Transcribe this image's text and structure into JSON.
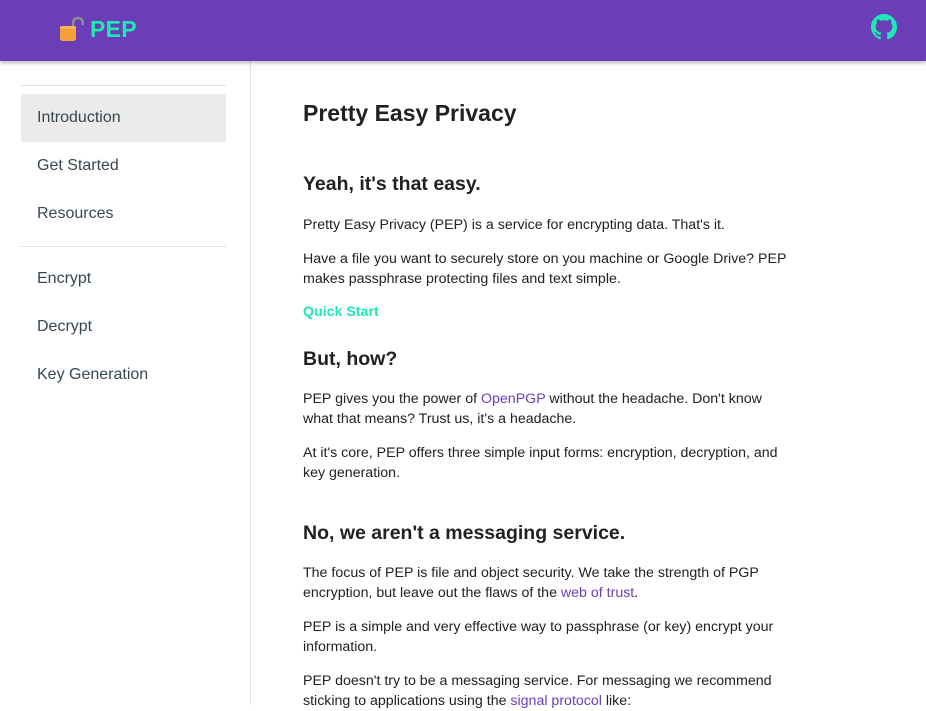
{
  "header": {
    "brand_name": "PEP",
    "logo_icon": "padlock-icon",
    "github_icon": "github-icon",
    "colors": {
      "bar": "#6b3eb8",
      "brand": "#1de9b6"
    }
  },
  "sidebar": {
    "group1": [
      {
        "label": "Introduction",
        "active": true
      },
      {
        "label": "Get Started"
      },
      {
        "label": "Resources"
      }
    ],
    "group2": [
      {
        "label": "Encrypt"
      },
      {
        "label": "Decrypt"
      },
      {
        "label": "Key Generation"
      }
    ]
  },
  "main": {
    "title": "Pretty Easy Privacy",
    "s1": {
      "heading": "Yeah, it's that easy.",
      "p1": "Pretty Easy Privacy (PEP) is a service for encrypting data. That's it.",
      "p2": "Have a file you want to securely store on you machine or Google Drive? PEP makes passphrase protecting files and text simple.",
      "cta": "Quick Start"
    },
    "s2": {
      "heading": "But, how?",
      "p1_pre": "PEP gives you the power of ",
      "p1_link": "OpenPGP",
      "p1_post": " without the headache. Don't know what that means? Trust us, it's a headache.",
      "p2": "At it's core, PEP offers three simple input forms: encryption, decryption, and key generation."
    },
    "s3": {
      "heading": "No, we aren't a messaging service.",
      "p1_pre": "The focus of PEP is file and object security. We take the strength of PGP encryption, but leave out the flaws of the ",
      "p1_link": "web of trust",
      "p1_post": ".",
      "p2": "PEP is a simple and very effective way to passphrase (or key) encrypt your information.",
      "p3_pre": "PEP doesn't try to be a messaging service. For messaging we recommend sticking to applications using the ",
      "p3_link": "signal protocol",
      "p3_post": " like:"
    }
  }
}
